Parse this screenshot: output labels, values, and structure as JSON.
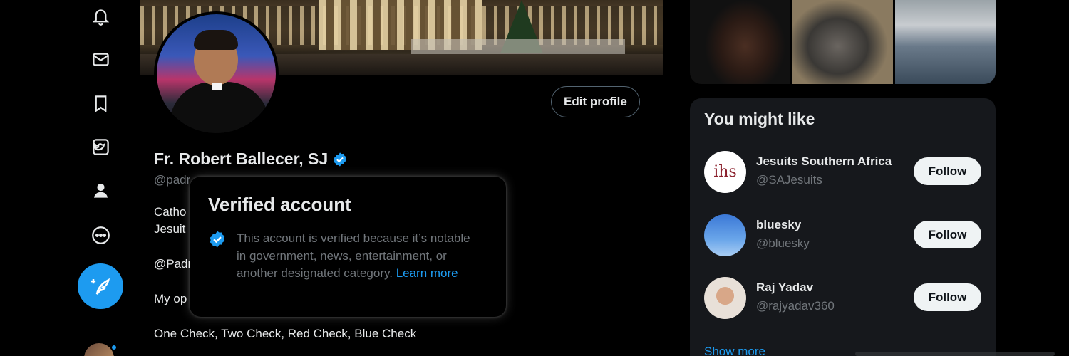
{
  "nav": {
    "items": [
      {
        "icon": "bell-icon"
      },
      {
        "icon": "mail-icon"
      },
      {
        "icon": "bookmark-icon"
      },
      {
        "icon": "premium-icon"
      },
      {
        "icon": "profile-icon"
      },
      {
        "icon": "more-icon"
      }
    ],
    "compose_icon": "compose-icon"
  },
  "profile": {
    "display_name": "Fr. Robert Ballecer, SJ",
    "handle": "@padr",
    "edit_label": "Edit profile",
    "bio_fragments": [
      "Catho",
      "Jesuit",
      "@Padr",
      "My op"
    ],
    "tagline": "One Check, Two Check, Red Check, Blue Check"
  },
  "popover": {
    "title": "Verified account",
    "text": "This account is verified because it’s notable in government, news, entertainment, or another designated category.",
    "link": "Learn more"
  },
  "who_to_follow": {
    "title": "You might like",
    "accounts": [
      {
        "name": "Jesuits Southern Africa",
        "handle": "@SAJesuits",
        "button": "Follow",
        "avatar_text": "ihs"
      },
      {
        "name": "bluesky",
        "handle": "@bluesky",
        "button": "Follow"
      },
      {
        "name": "Raj Yadav",
        "handle": "@rajyadav360",
        "button": "Follow"
      }
    ],
    "show_more": "Show more"
  },
  "colors": {
    "accent": "#1d9bf0",
    "background": "#000000",
    "card": "#16181c",
    "muted_text": "#71767b"
  }
}
